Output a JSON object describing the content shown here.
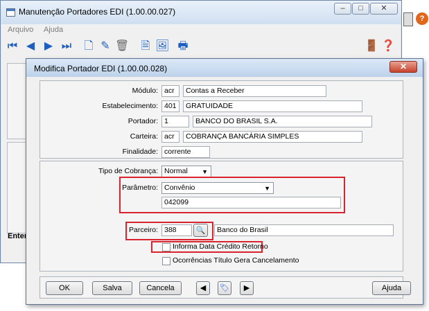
{
  "back_window": {
    "title": "Manutenção Portadores EDI (1.00.00.027)",
    "menu": [
      "Arquivo",
      "Ajuda"
    ],
    "side_label": "Enter"
  },
  "dialog": {
    "title": "Modifica Portador EDI (1.00.00.028)",
    "fields": {
      "modulo": {
        "label": "Módulo:",
        "code": "acr",
        "desc": "Contas a Receber"
      },
      "estabelecimento": {
        "label": "Estabelecimento:",
        "code": "401",
        "desc": "GRATUIDADE"
      },
      "portador": {
        "label": "Portador:",
        "code": "1",
        "desc": "BANCO DO BRASIL S.A."
      },
      "carteira": {
        "label": "Carteira:",
        "code": "acr",
        "desc": "COBRANÇA BANCÁRIA SIMPLES"
      },
      "finalidade": {
        "label": "Finalidade:",
        "value": "corrente"
      }
    },
    "tipo_cobranca": {
      "label": "Tipo de Cobrança:",
      "value": "Normal"
    },
    "parametro": {
      "label": "Parâmetro:",
      "value": "Convênio",
      "input": "042099"
    },
    "parceiro": {
      "label": "Parceiro:",
      "code": "388",
      "desc": "Banco do Brasil"
    },
    "checkboxes": {
      "informa": "Informa Data Crédito Retorno",
      "ocorrencias": "Ocorrências Título Gera Cancelamento"
    },
    "buttons": {
      "ok": "OK",
      "salva": "Salva",
      "cancela": "Cancela",
      "ajuda": "Ajuda"
    }
  },
  "colors": {
    "highlight": "#d9232f",
    "title_bar": "#cfdff0"
  }
}
